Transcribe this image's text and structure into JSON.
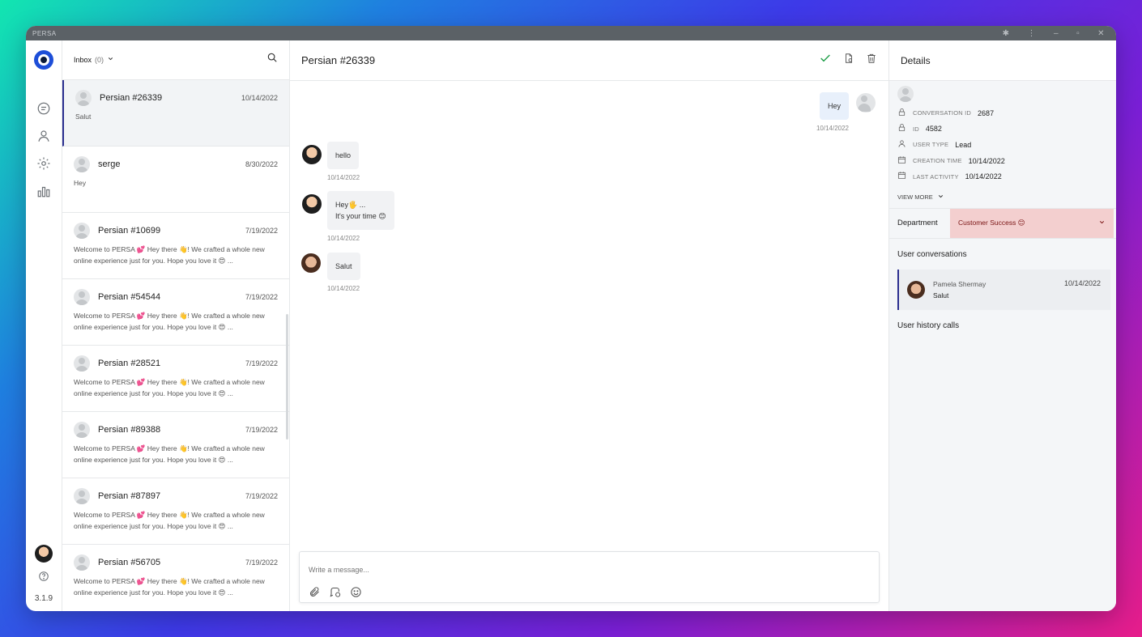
{
  "window": {
    "title": "PERSA"
  },
  "rail": {
    "version": "3.1.9"
  },
  "list": {
    "inbox_label": "Inbox",
    "inbox_count": "(0)",
    "conversations": [
      {
        "name": "Persian #26339",
        "date": "10/14/2022",
        "preview": "Salut"
      },
      {
        "name": "serge",
        "date": "8/30/2022",
        "preview": "Hey"
      },
      {
        "name": "Persian #10699",
        "date": "7/19/2022",
        "preview": "Welcome to PERSA 💕 Hey there 👋! We crafted a whole new online experience just for you. Hope you love it 😍 ..."
      },
      {
        "name": "Persian #54544",
        "date": "7/19/2022",
        "preview": "Welcome to PERSA 💕 Hey there 👋! We crafted a whole new online experience just for you. Hope you love it 😍 ..."
      },
      {
        "name": "Persian #28521",
        "date": "7/19/2022",
        "preview": "Welcome to PERSA 💕 Hey there 👋! We crafted a whole new online experience just for you. Hope you love it 😍 ..."
      },
      {
        "name": "Persian #89388",
        "date": "7/19/2022",
        "preview": "Welcome to PERSA 💕 Hey there 👋! We crafted a whole new online experience just for you. Hope you love it 😍 ..."
      },
      {
        "name": "Persian #87897",
        "date": "7/19/2022",
        "preview": "Welcome to PERSA 💕 Hey there 👋! We crafted a whole new online experience just for you. Hope you love it 😍 ..."
      },
      {
        "name": "Persian #56705",
        "date": "7/19/2022",
        "preview": "Welcome to PERSA 💕 Hey there 👋! We crafted a whole new online experience just for you. Hope you love it 😍 ..."
      }
    ]
  },
  "chat": {
    "title": "Persian #26339",
    "messages": [
      {
        "text": "Hey",
        "time": "10/14/2022"
      },
      {
        "text": "hello",
        "time": "10/14/2022"
      },
      {
        "text_line1": "Hey🖐 ...",
        "text_line2": "It's your time 😊",
        "time": "10/14/2022"
      },
      {
        "text": "Salut",
        "time": "10/14/2022"
      }
    ],
    "composer_placeholder": "Write a message..."
  },
  "details": {
    "title": "Details",
    "fields": [
      {
        "key": "Conversation ID",
        "value": "2687"
      },
      {
        "key": "ID",
        "value": "4582"
      },
      {
        "key": "User type",
        "value": "Lead"
      },
      {
        "key": "Creation time",
        "value": "10/14/2022"
      },
      {
        "key": "Last activity",
        "value": "10/14/2022"
      }
    ],
    "view_more": "VIEW MORE",
    "department_label": "Department",
    "department_value": "Customer Success 😊",
    "user_conversations_title": "User conversations",
    "user_conversation": {
      "name": "Pamela Shermay",
      "text": "Salut",
      "date": "10/14/2022"
    },
    "user_history_title": "User history calls"
  },
  "colors": {
    "accent": "#2b2f8f",
    "department_bg": "#f3cfcf",
    "check": "#22a04b"
  }
}
